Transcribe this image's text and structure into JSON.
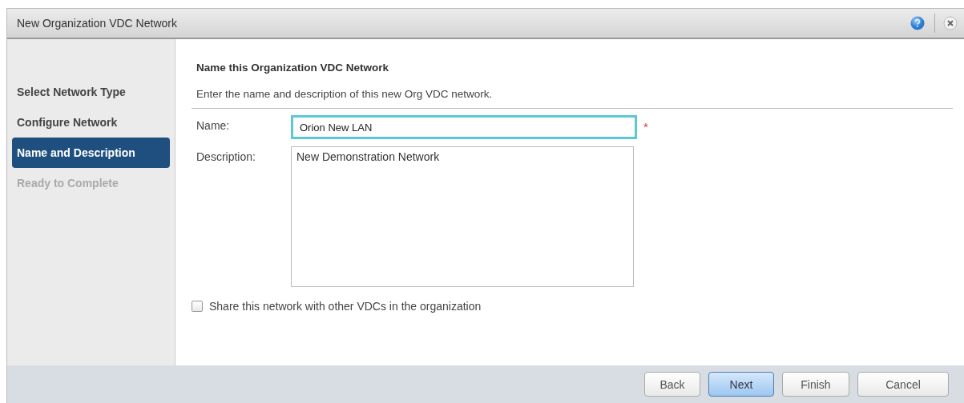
{
  "window": {
    "title": "New Organization VDC Network"
  },
  "steps": [
    {
      "label": "Select Network Type",
      "selected": false,
      "disabled": false
    },
    {
      "label": "Configure Network",
      "selected": false,
      "disabled": false
    },
    {
      "label": "Name and Description",
      "selected": true,
      "disabled": false
    },
    {
      "label": "Ready to Complete",
      "selected": false,
      "disabled": true
    }
  ],
  "page": {
    "heading": "Name this Organization VDC Network",
    "instructions": "Enter the name and description of this new Org VDC network.",
    "name_label": "Name:",
    "name_value": "Orion New LAN",
    "name_focused": true,
    "required_mark": "*",
    "description_label": "Description:",
    "description_value": "New Demonstration Network",
    "share": {
      "label": "Share this network with other VDCs in the organization",
      "checked": false
    }
  },
  "buttons": [
    {
      "label": "Back",
      "kind": "normal"
    },
    {
      "label": "Next",
      "kind": "primary"
    },
    {
      "label": "Finish",
      "kind": "normal"
    },
    {
      "label": "Cancel",
      "kind": "normal"
    }
  ]
}
